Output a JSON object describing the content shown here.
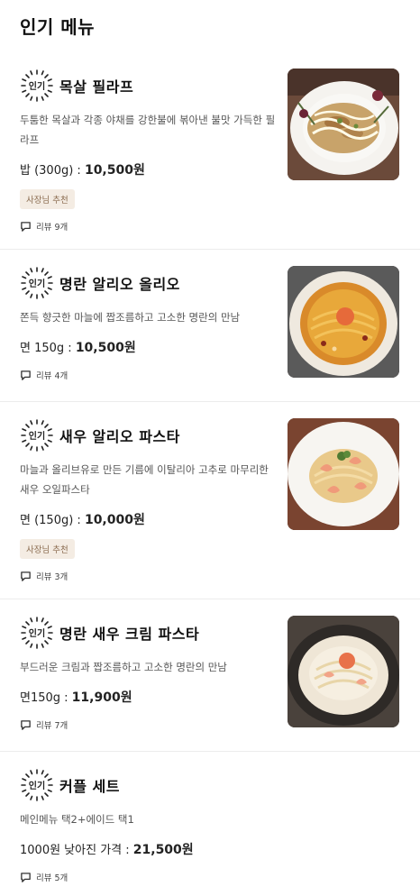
{
  "header": {
    "title": "인기 메뉴"
  },
  "badge_text": "인기",
  "items": [
    {
      "name": "목살 필라프",
      "description": "두툼한 목살과 각종 야채를 강한불에 볶아낸 불맛 가득한 필라프",
      "price_label": "밥 (300g) : ",
      "price_amount": "10,500원",
      "chip": "사장님 추천",
      "reviews": "리뷰 9개",
      "image_icon": "pilaf-photo"
    },
    {
      "name": "명란 알리오 올리오",
      "description": "쫀득 향긋한 마늘에 짭조름하고 고소한 명란의 만남",
      "price_label": "면 150g : ",
      "price_amount": "10,500원",
      "chip": null,
      "reviews": "리뷰 4개",
      "image_icon": "aglio-olio-photo"
    },
    {
      "name": "새우 알리오 파스타",
      "description": "마늘과 올리브유로 만든 기름에 이탈리아 고추로 마무리한 새우 오일파스타",
      "price_label": "면 (150g) : ",
      "price_amount": "10,000원",
      "chip": "사장님 추천",
      "reviews": "리뷰 3개",
      "image_icon": "shrimp-pasta-photo"
    },
    {
      "name": "명란 새우 크림 파스타",
      "description": "부드러운 크림과 짭조름하고 고소한 명란의 만남",
      "price_label": "면150g : ",
      "price_amount": "11,900원",
      "chip": null,
      "reviews": "리뷰 7개",
      "image_icon": "cream-pasta-photo"
    },
    {
      "name": "커플 세트",
      "description": "메인메뉴 택2+에이드 택1",
      "price_label": "1000원 낮아진 가격 : ",
      "price_amount": "21,500원",
      "chip": null,
      "reviews": "리뷰 5개",
      "image_icon": null
    }
  ]
}
